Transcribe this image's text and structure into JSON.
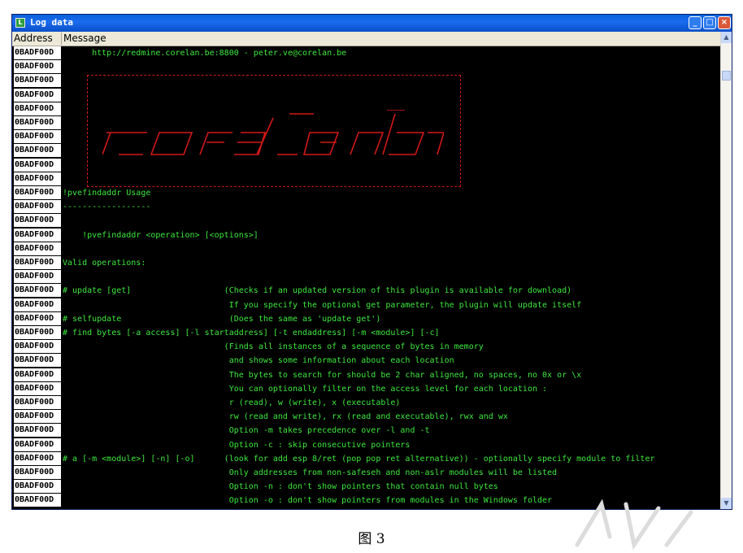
{
  "window": {
    "title": "Log data"
  },
  "columns": {
    "address": "Address",
    "message": "Message"
  },
  "rows": [
    {
      "address": "0BADF00D",
      "message": "      http://redmine.corelan.be:8800 - peter.ve@corelan.be"
    },
    {
      "address": "0BADF00D",
      "message": ""
    },
    {
      "address": "0BADF00D",
      "message": ""
    },
    {
      "address": "0BADF00D",
      "message": ""
    },
    {
      "address": "0BADF00D",
      "message": ""
    },
    {
      "address": "0BADF00D",
      "message": ""
    },
    {
      "address": "0BADF00D",
      "message": ""
    },
    {
      "address": "0BADF00D",
      "message": ""
    },
    {
      "address": "0BADF00D",
      "message": ""
    },
    {
      "address": "0BADF00D",
      "message": ""
    },
    {
      "address": "0BADF00D",
      "message": "!pvefindaddr Usage"
    },
    {
      "address": "0BADF00D",
      "message": "------------------"
    },
    {
      "address": "0BADF00D",
      "message": ""
    },
    {
      "address": "0BADF00D",
      "message": "    !pvefindaddr <operation> [<options>]"
    },
    {
      "address": "0BADF00D",
      "message": ""
    },
    {
      "address": "0BADF00D",
      "message": "Valid operations:"
    },
    {
      "address": "0BADF00D",
      "message": ""
    },
    {
      "address": "0BADF00D",
      "message": "# update [get]                   (Checks if an updated version of this plugin is available for download)"
    },
    {
      "address": "0BADF00D",
      "message": "                                  If you specify the optional get parameter, the plugin will update itself"
    },
    {
      "address": "0BADF00D",
      "message": "# selfupdate                      (Does the same as 'update get')"
    },
    {
      "address": "0BADF00D",
      "message": "# find bytes [-a access] [-l startaddress] [-t endaddress] [-m <module>] [-c]"
    },
    {
      "address": "0BADF00D",
      "message": "                                 (Finds all instances of a sequence of bytes in memory"
    },
    {
      "address": "0BADF00D",
      "message": "                                  and shows some information about each location"
    },
    {
      "address": "0BADF00D",
      "message": "                                  The bytes to search for should be 2 char aligned, no spaces, no 0x or \\x"
    },
    {
      "address": "0BADF00D",
      "message": "                                  You can optionally filter on the access level for each location :"
    },
    {
      "address": "0BADF00D",
      "message": "                                  r (read), w (write), x (executable)"
    },
    {
      "address": "0BADF00D",
      "message": "                                  rw (read and write), rx (read and executable), rwx and wx"
    },
    {
      "address": "0BADF00D",
      "message": "                                  Option -m takes precedence over -l and -t"
    },
    {
      "address": "0BADF00D",
      "message": "                                  Option -c : skip consecutive pointers"
    },
    {
      "address": "0BADF00D",
      "message": "# a [-m <module>] [-n] [-o]      (look for add esp 8/ret (pop pop ret alternative)) - optionally specify module to filter"
    },
    {
      "address": "0BADF00D",
      "message": "                                  Only addresses from non-safeseh and non-aslr modules will be listed"
    },
    {
      "address": "0BADF00D",
      "message": "                                  Option -n : don't show pointers that contain null bytes"
    },
    {
      "address": "0BADF00D",
      "message": "                                  Option -o : don't show pointers from modules in the Windows folder"
    }
  ],
  "caption": "图 3",
  "colors": {
    "text": "#3ee83e",
    "background": "#000000",
    "banner": "#d21818"
  }
}
